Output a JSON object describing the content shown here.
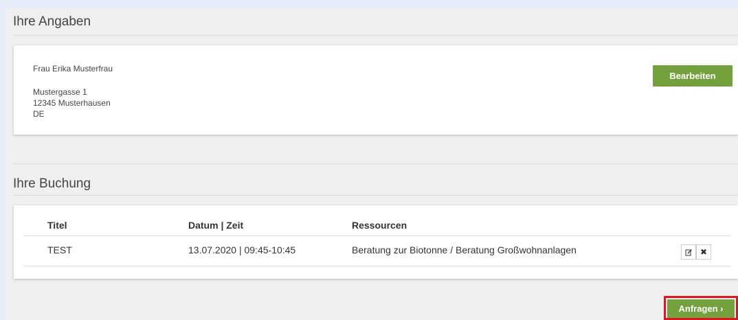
{
  "angaben": {
    "title": "Ihre Angaben",
    "name": "Frau Erika Musterfrau",
    "street": "Mustergasse 1",
    "city": "12345 Musterhausen",
    "country": "DE",
    "edit_label": "Bearbeiten"
  },
  "buchung": {
    "title": "Ihre Buchung",
    "columns": [
      "Titel",
      "Datum | Zeit",
      "Ressourcen"
    ],
    "rows": [
      {
        "titel": "TEST",
        "datum": "13.07.2020 | 09:45-10:45",
        "ressourcen": "Beratung zur Biotonne / Beratung Großwohnanlagen"
      }
    ]
  },
  "actions": {
    "submit_label": "Anfragen ›"
  },
  "colors": {
    "accent_green": "#75a03e",
    "highlight_red": "#e0141e",
    "background": "#e6edf8"
  },
  "icons": {
    "edit": "edit-icon",
    "delete": "delete-icon"
  }
}
